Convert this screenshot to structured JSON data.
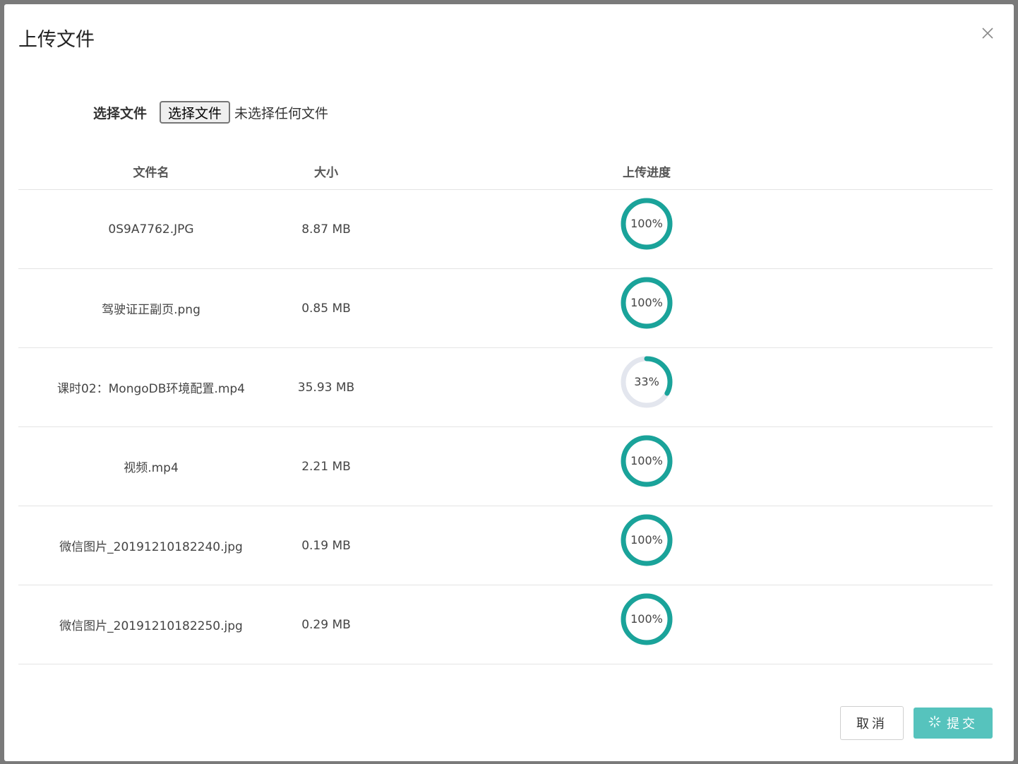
{
  "dialog": {
    "title": "上传文件",
    "close_icon": "close-icon"
  },
  "file_input": {
    "label": "选择文件",
    "button_label": "选择文件",
    "status": "未选择任何文件"
  },
  "table": {
    "headers": {
      "name": "文件名",
      "size": "大小",
      "progress": "上传进度"
    },
    "rows": [
      {
        "name": "0S9A7762.JPG",
        "size": "8.87 MB",
        "progress": 100,
        "progress_label": "100%"
      },
      {
        "name": "驾驶证正副页.png",
        "size": "0.85 MB",
        "progress": 100,
        "progress_label": "100%"
      },
      {
        "name": "课时02：MongoDB环境配置.mp4",
        "size": "35.93 MB",
        "progress": 33,
        "progress_label": "33%"
      },
      {
        "name": "视频.mp4",
        "size": "2.21 MB",
        "progress": 100,
        "progress_label": "100%"
      },
      {
        "name": "微信图片_20191210182240.jpg",
        "size": "0.19 MB",
        "progress": 100,
        "progress_label": "100%"
      },
      {
        "name": "微信图片_20191210182250.jpg",
        "size": "0.29 MB",
        "progress": 100,
        "progress_label": "100%"
      }
    ]
  },
  "footer": {
    "cancel_label": "取消",
    "submit_label": "提交",
    "submit_icon": "loading-spinner-icon"
  },
  "colors": {
    "progress_fill": "#1aa39a",
    "progress_track": "#e3e6ee",
    "submit_bg": "#56c3bd"
  }
}
